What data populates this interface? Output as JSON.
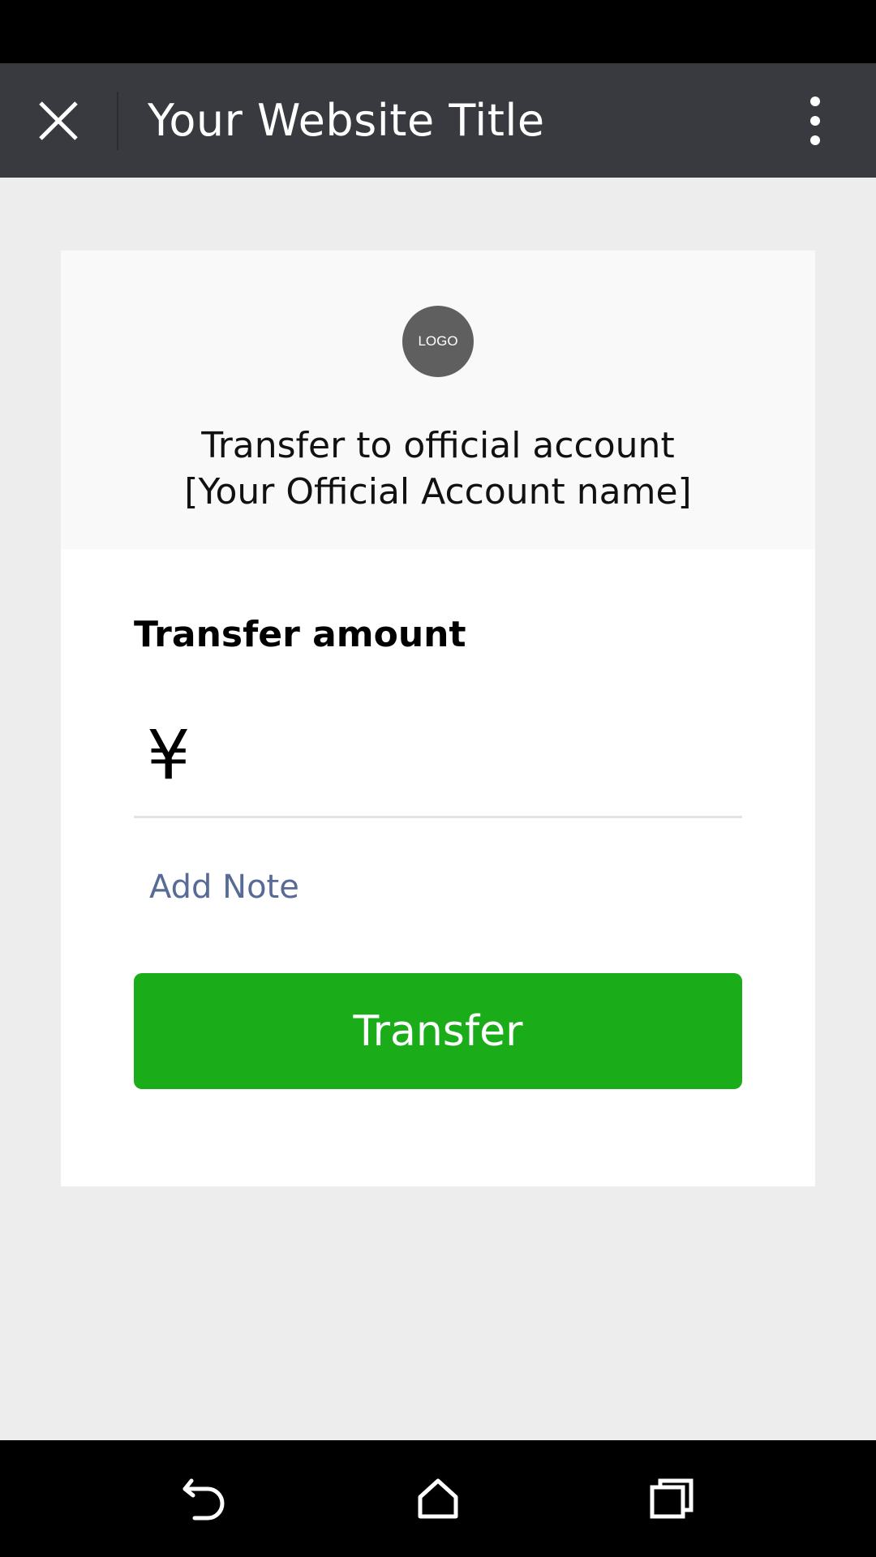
{
  "header": {
    "title": "Your Website Title",
    "close_icon": "close-icon",
    "more_icon": "more-vertical-icon"
  },
  "card": {
    "logo_text": "LOGO",
    "recipient_line1": "Transfer to official account",
    "recipient_line2": "[Your Official Account name]",
    "amount_label": "Transfer amount",
    "currency_symbol": "¥",
    "amount_value": "",
    "add_note_label": "Add Note",
    "transfer_button_label": "Transfer"
  },
  "nav": {
    "back_icon": "back-icon",
    "home_icon": "home-icon",
    "recents_icon": "recents-icon"
  },
  "colors": {
    "title_bar": "#393a3f",
    "page_background": "#ededed",
    "primary_button": "#1aad19",
    "link": "#576b95",
    "logo_background": "#5f5f5f"
  }
}
